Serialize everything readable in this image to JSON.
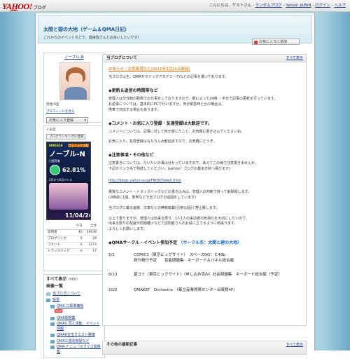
{
  "topbar": {
    "logo_text": "YAHOO!",
    "logo_sub": "JAPAN",
    "logo_blog": "ブログ",
    "greeting": "こんにちは、ゲストさん",
    "links": [
      "ランダムブログ",
      "Yahoo! JAPAN",
      "ログイン",
      "ヘルプ"
    ]
  },
  "header": {
    "title": "太閤と碧の大地（ゲーム＆QMA日記）",
    "description": "これからのイベントなどで、直接皆さんとお会いしたいです！",
    "favorite_button": "お気に入りに追加"
  },
  "sidebar": {
    "username": "ノーブル-N",
    "gender_label": "男性/O型",
    "profile_link": "プロフィールを見る",
    "favorite_select": "お気に入り登録",
    "rank_label": "人気度",
    "rank_button": "ブログランキングに登録",
    "banner": {
      "id": "8001626",
      "badge": "フェニックス組",
      "name": "ノーブル-N",
      "class": "日経賢者",
      "rate": "62.81%",
      "sub": "5月から6月バトル",
      "date": "11/04/24"
    },
    "stats": {
      "header": [
        "今日",
        "全体"
      ],
      "rows": [
        {
          "label": "訪問者",
          "today": "40",
          "total": "59039"
        },
        {
          "label": "ブログリンク",
          "today": "0",
          "total": "29"
        },
        {
          "label": "コメント",
          "today": "0",
          "total": "1173"
        },
        {
          "label": "トラックバック",
          "today": "0",
          "total": "17"
        }
      ]
    },
    "articles_title": "すべて表示",
    "articles_count": "(460)",
    "image_list": "画像一覧",
    "about_link": "当ブログについて",
    "categories": [
      "投票",
      "QMA 三軍準備館",
      "QMA問題集",
      "QMA5 同人活動、イベント情報",
      "QMA6宝玉クエスト勝率",
      "QMA三国志部屋など",
      "QMA 7 ニュースクイズ問題集"
    ],
    "new_badge": "NEW"
  },
  "main": {
    "card_title": "当ブログについて",
    "all_link": "すべて表示",
    "notice_title": "お知らせ・注意事項など(2011年3月21日更新)",
    "intro": "当ブログは主、QMA7(マジックアカデミー7)などの記事を書いております。",
    "sections": [
      {
        "heading": "◆更新＆返信の時間帯など",
        "paras": [
          "管理人は交代制の勤務でお仕事をしておりますので、曜によって24時 ・半日で記事の更新を行っています。",
          "お返事については、基本的にPCで行いますが、何か緊急時とかの場合は、",
          "携帯で対応する場合もあります。"
        ]
      },
      {
        "heading": "◆コメント・お気に入り登録・友達登録は大歓迎です。",
        "paras": [
          "コメントについては、記事に対して何か感じたこと、お気軽に書き込んでくださいね。",
          "お気に入り、友達登録はもちろん大歓迎ますので、お気軽にどうぞ。"
        ]
      },
      {
        "heading": "◆注意事項・その他など",
        "paras": [
          "注意書きについては、だいたいの事は分かっていますので、あえてこの様で注意書きませんが、",
          "下記のリンク先で熟読してください。(yahoo！ブログの基本方針へ飛びます)"
        ]
      }
    ],
    "url": "http://blogs.yahoo.co.jp/FRONT/wish.html",
    "more_paras": [
      "悪質なコメント・トラックバックなどの書き込みは、管理人の判断で持って削除致します。",
      "(2時間に1回、携帯などで当ブログの巡回をしています)",
      "当ブログに載る画像、文章などの無断転載(引用)は固く禁止致します。",
      "以上で書りますが、管理人は出来る限り、1人1人の来訪者の気持ちを大切にしたいので、",
      "出来る限りの配慮や問題確けなどで訪問者さんのお役に立てるように頑張ります。",
      "よろしくお願いします。"
    ],
    "circle_heading": "◆QMAサークル・イベント参加予定",
    "circle_name": "（サークル名：太閤と碧の大地）",
    "events": [
      {
        "date": "5/1",
        "line1": "COMIC1（東京ビッグサイト）　スペースNO：と48b",
        "line2": "新刊発行予定　　芸能問題集　キーボード＆パネル総合編"
      },
      {
        "date": "8/13",
        "line1": "夏コミ（東京ビッグサイト）（申し込み済み）社会問題集　キーボード総合編（予定）",
        "line2": ""
      },
      {
        "date": "10/2",
        "line1": "QMAKET　Orchestra　（都立産業貿易センター台東館4F）",
        "line2": ""
      }
    ],
    "latest_title": "その他の最新記事",
    "latest_all": "すべて表示"
  }
}
